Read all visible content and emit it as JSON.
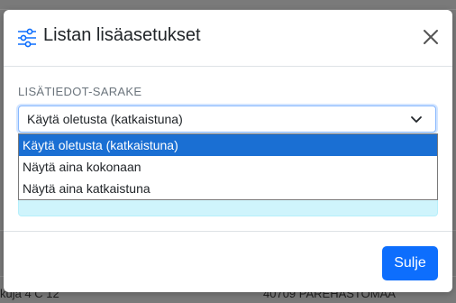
{
  "background": {
    "bottom_left_text": "kuja 4 C 12",
    "bottom_right_text": "40709 PAREHASTOMAA"
  },
  "modal": {
    "title": "Listan lisäasetukset",
    "title_icon": "sliders-icon",
    "close_icon": "close-icon",
    "section_label": "LISÄTIEDOT-SARAKE",
    "select": {
      "value": "Käytä oletusta (katkaistuna)",
      "chevron_icon": "chevron-down-icon",
      "options": [
        "Käytä oletusta (katkaistuna)",
        "Näytä aina kokonaan",
        "Näytä aina katkaistuna"
      ]
    },
    "footer": {
      "close_label": "Sulje"
    }
  },
  "colors": {
    "primary": "#0d6efd",
    "selected_option": "#1a6fd3",
    "info_background": "#cff4fc",
    "backdrop": "#7a7a7a"
  }
}
